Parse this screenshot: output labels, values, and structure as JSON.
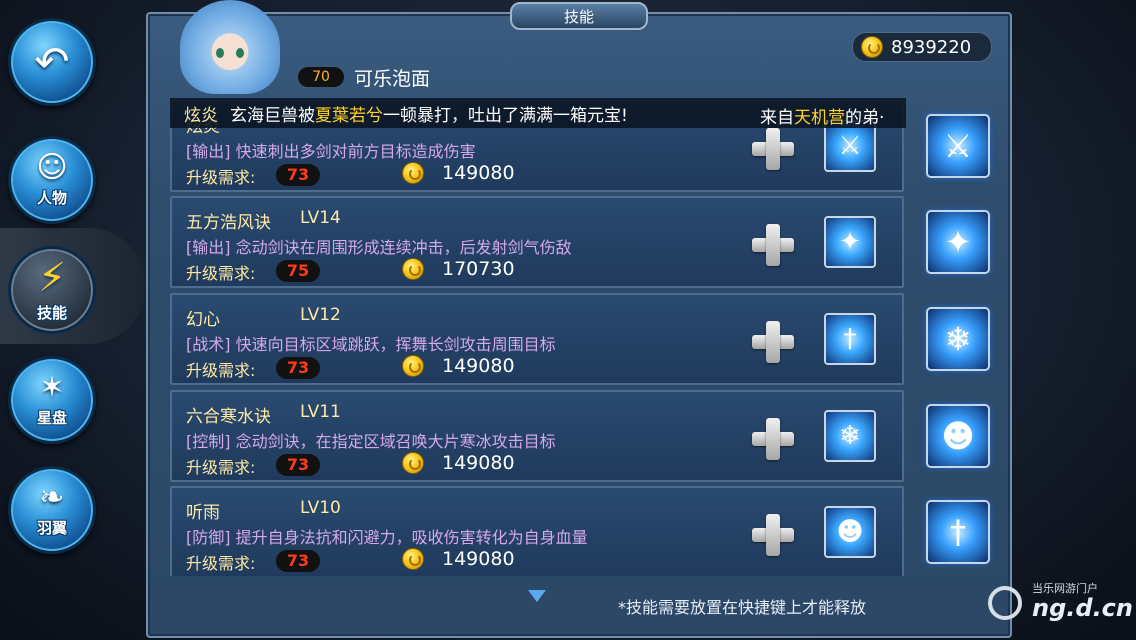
{
  "window": {
    "title": "技能"
  },
  "player": {
    "level": "70",
    "name": "可乐泡面",
    "gold": "8939220"
  },
  "sidebar": {
    "items": [
      {
        "label": "",
        "icon": "back-arrow-icon"
      },
      {
        "label": "人物",
        "icon": "character-icon"
      },
      {
        "label": "技能",
        "icon": "skill-icon"
      },
      {
        "label": "星盘",
        "icon": "star-chart-icon"
      },
      {
        "label": "羽翼",
        "icon": "wings-icon"
      }
    ]
  },
  "broadcast": {
    "tag": "炫炎",
    "text_before": "玄海巨兽被",
    "highlight_name": "夏葉若兮",
    "text_after": "一顿暴打，吐出了满满一箱元宝!",
    "right_prefix": "来自",
    "right_highlight": "天机营",
    "right_suffix": "的弟·"
  },
  "req_label": "升级需求:",
  "skills": [
    {
      "name": "炫炎",
      "level": "",
      "desc": "[输出] 快速刺出多剑对前方目标造成伤害",
      "req_level": "73",
      "cost": "149080"
    },
    {
      "name": "五方浩风诀",
      "level": "LV14",
      "desc": "[输出] 念动剑诀在周围形成连续冲击，后发射剑气伤敌",
      "req_level": "75",
      "cost": "170730"
    },
    {
      "name": "幻心",
      "level": "LV12",
      "desc": "[战术] 快速向目标区域跳跃，挥舞长剑攻击周围目标",
      "req_level": "73",
      "cost": "149080"
    },
    {
      "name": "六合寒水诀",
      "level": "LV11",
      "desc": "[控制] 念动剑诀，在指定区域召唤大片寒冰攻击目标",
      "req_level": "73",
      "cost": "149080"
    },
    {
      "name": "听雨",
      "level": "LV10",
      "desc": "[防御] 提升自身法抗和闪避力，吸收伤害转化为自身血量",
      "req_level": "73",
      "cost": "149080"
    }
  ],
  "footer": {
    "hint": "*技能需要放置在快捷键上才能释放"
  },
  "watermark": {
    "top": "当乐网游门户",
    "main": "ng.d.cn"
  }
}
